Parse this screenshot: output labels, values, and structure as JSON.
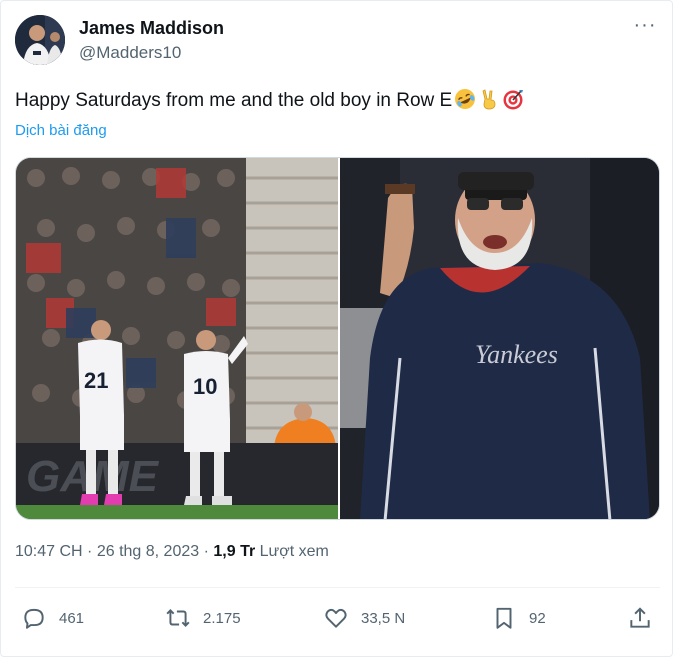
{
  "author": {
    "name": "James Maddison",
    "handle": "@Madders10"
  },
  "tweet": {
    "text": "Happy Saturdays from me and the old boy in Row E",
    "emojis": [
      "rolling-on-floor-laughing-emoji",
      "victory-hand-emoji",
      "direct-hit-emoji"
    ],
    "translate_label": "Dịch bài đăng"
  },
  "media": {
    "left_jersey": "21",
    "left_jersey_10": "10",
    "left_board_text": "GAME",
    "right_jacket_text": "Yankees"
  },
  "meta": {
    "time": "10:47 CH",
    "date": "26 thg 8, 2023",
    "views_count": "1,9 Tr",
    "views_label": "Lượt xem",
    "separator": "·"
  },
  "actions": {
    "replies": "461",
    "reposts": "2.175",
    "likes": "33,5 N",
    "bookmarks": "92"
  },
  "colors": {
    "link": "#1d9bf0",
    "secondary": "#536471",
    "primary": "#0f1419"
  }
}
